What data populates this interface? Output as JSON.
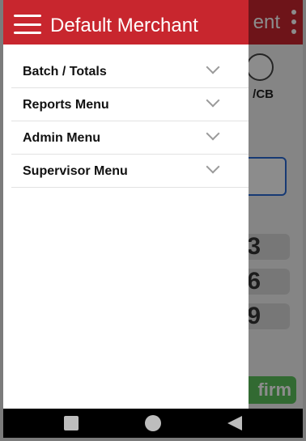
{
  "background": {
    "header_title_partial": "ent",
    "card_label_partial": "/CB",
    "keys": [
      "3",
      "6",
      "9"
    ],
    "confirm_partial": "firm"
  },
  "drawer": {
    "title": "Default Merchant",
    "items": [
      {
        "label": "Batch / Totals"
      },
      {
        "label": "Reports Menu"
      },
      {
        "label": "Admin Menu"
      },
      {
        "label": "Supervisor Menu"
      }
    ]
  },
  "colors": {
    "brand_red": "#c8262e",
    "confirm_green": "#5cc15c",
    "field_border_blue": "#2a6ad4"
  },
  "icons": {
    "menu": "hamburger-menu-icon",
    "expand": "chevron-down-icon",
    "nav_recents": "square-icon",
    "nav_home": "circle-icon",
    "nav_back": "triangle-back-icon"
  }
}
